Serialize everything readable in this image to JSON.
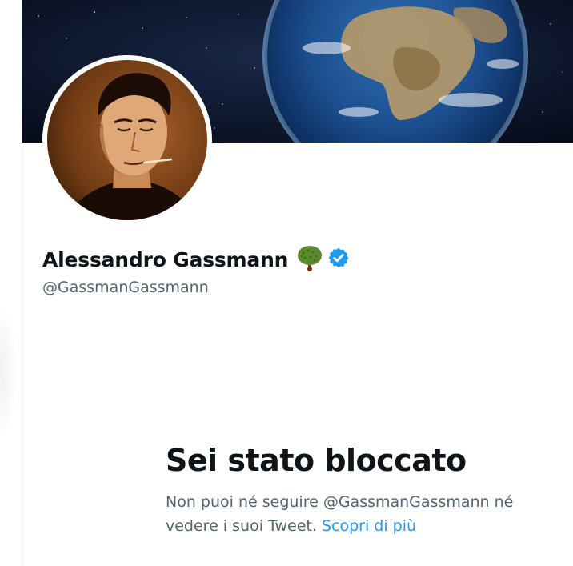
{
  "profile": {
    "display_name": "Alessandro Gassmann",
    "handle": "@GassmanGassmann",
    "badge_emoji": "deciduous-tree-emoji",
    "verified": true
  },
  "blocked_notice": {
    "title": "Sei stato bloccato",
    "body_line1": "Non puoi né seguire @GassmanGassmann né",
    "body_line2": "vedere i suoi Tweet.",
    "learn_more_label": "Scopri di più"
  },
  "colors": {
    "text_primary": "#0f1419",
    "text_secondary": "#536471",
    "link": "#1d9bf0",
    "verified_badge": "#1d9bf0",
    "avatar_tint": "#8a4a1c"
  },
  "icons": {
    "verified": "verified-badge-icon",
    "tree": "tree-emoji-icon"
  }
}
